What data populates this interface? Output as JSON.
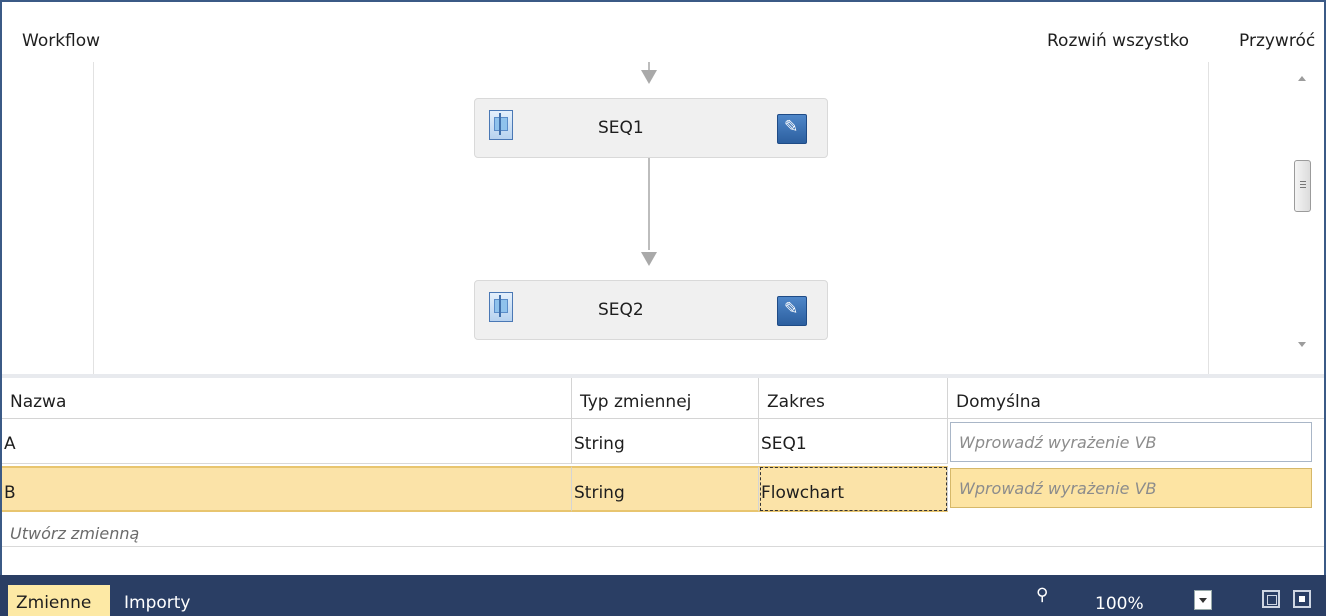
{
  "header": {
    "title": "Workflow",
    "expand_all": "Rozwiń wszystko",
    "restore": "Przywróć"
  },
  "canvas": {
    "activities": [
      {
        "label": "SEQ1",
        "icon": "sequence-icon",
        "edit_icon": "pencil-icon"
      },
      {
        "label": "SEQ2",
        "icon": "sequence-icon",
        "edit_icon": "pencil-icon"
      }
    ]
  },
  "variables": {
    "columns": [
      "Nazwa",
      "Typ zmiennej",
      "Zakres",
      "Domyślna"
    ],
    "rows": [
      {
        "name": "A",
        "type": "String",
        "scope": "SEQ1",
        "default_placeholder": "Wprowadź wyrażenie VB",
        "selected": false
      },
      {
        "name": "B",
        "type": "String",
        "scope": "Flowchart",
        "default_placeholder": "Wprowadź wyrażenie VB",
        "selected": true
      }
    ],
    "create_label": "Utwórz zmienną"
  },
  "statusbar": {
    "tabs": [
      {
        "label": "Zmienne",
        "active": true
      },
      {
        "label": "Importy",
        "active": false
      }
    ],
    "zoom_icon": "magnifier-icon",
    "zoom": "100%",
    "fit_icon": "fit-to-screen-icon",
    "overview_icon": "overview-icon"
  },
  "colors": {
    "bar": "#2a3e64",
    "selected_row": "#fbe3a8",
    "active_tab": "#fde9a5",
    "edit_button": "#3a6fb2"
  }
}
